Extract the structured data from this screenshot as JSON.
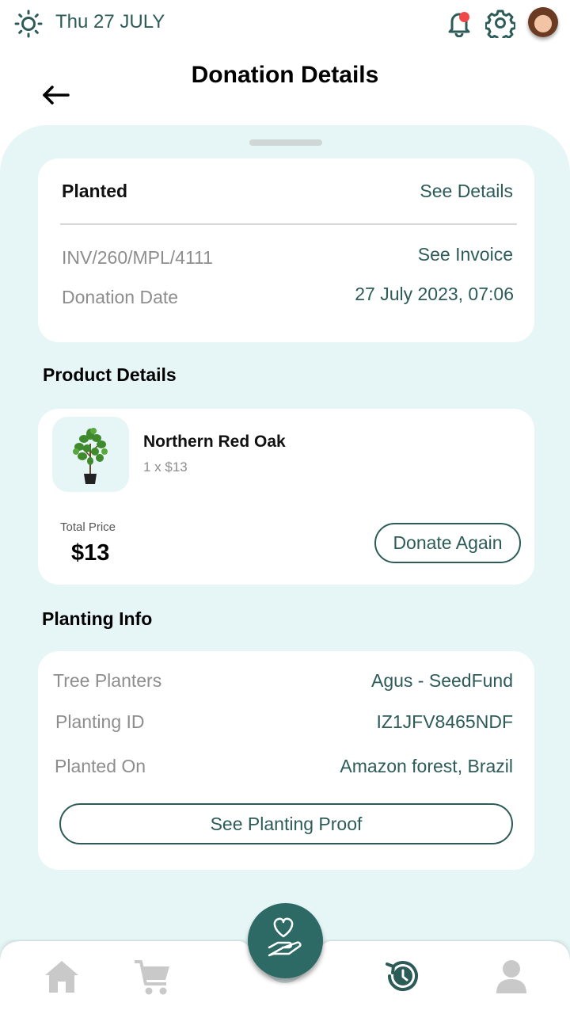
{
  "topbar": {
    "date": "Thu 27 JULY",
    "icons": [
      "sun-icon",
      "bell-icon",
      "gear-icon",
      "avatar"
    ],
    "notification_dot_color": "#f04848"
  },
  "header": {
    "title": "Donation Details",
    "back_icon": "arrow-left-icon"
  },
  "summary": {
    "status": "Planted",
    "see_details_label": "See Details",
    "invoice_number": "INV/260/MPL/4111",
    "see_invoice_label": "See Invoice",
    "donation_date_label": "Donation Date",
    "donation_date_value": "27 July 2023, 07:06"
  },
  "product_section": {
    "title": "Product Details",
    "product": {
      "name": "Northern Red Oak",
      "quantity_price": "1 x $13",
      "image_icon": "potted-tree-icon"
    },
    "total_label": "Total Price",
    "total_value": "$13",
    "donate_again_label": "Donate Again"
  },
  "planting_section": {
    "title": "Planting Info",
    "rows": [
      {
        "label": "Tree Planters",
        "value": "Agus - SeedFund"
      },
      {
        "label": "Planting ID",
        "value": "IZ1JFV8465NDF"
      },
      {
        "label": "Planted On",
        "value": "Amazon forest, Brazil"
      }
    ],
    "proof_button_label": "See Planting Proof"
  },
  "bottom_nav": {
    "items": [
      "home-icon",
      "cart-icon",
      "donate-hand-heart-icon",
      "history-icon",
      "profile-icon"
    ],
    "active": "history-icon"
  },
  "colors": {
    "accent": "#2d5b58",
    "fab": "#2d6a65",
    "sheet_background": "#e6f5f5",
    "inactive_nav": "#c9c9c9"
  }
}
